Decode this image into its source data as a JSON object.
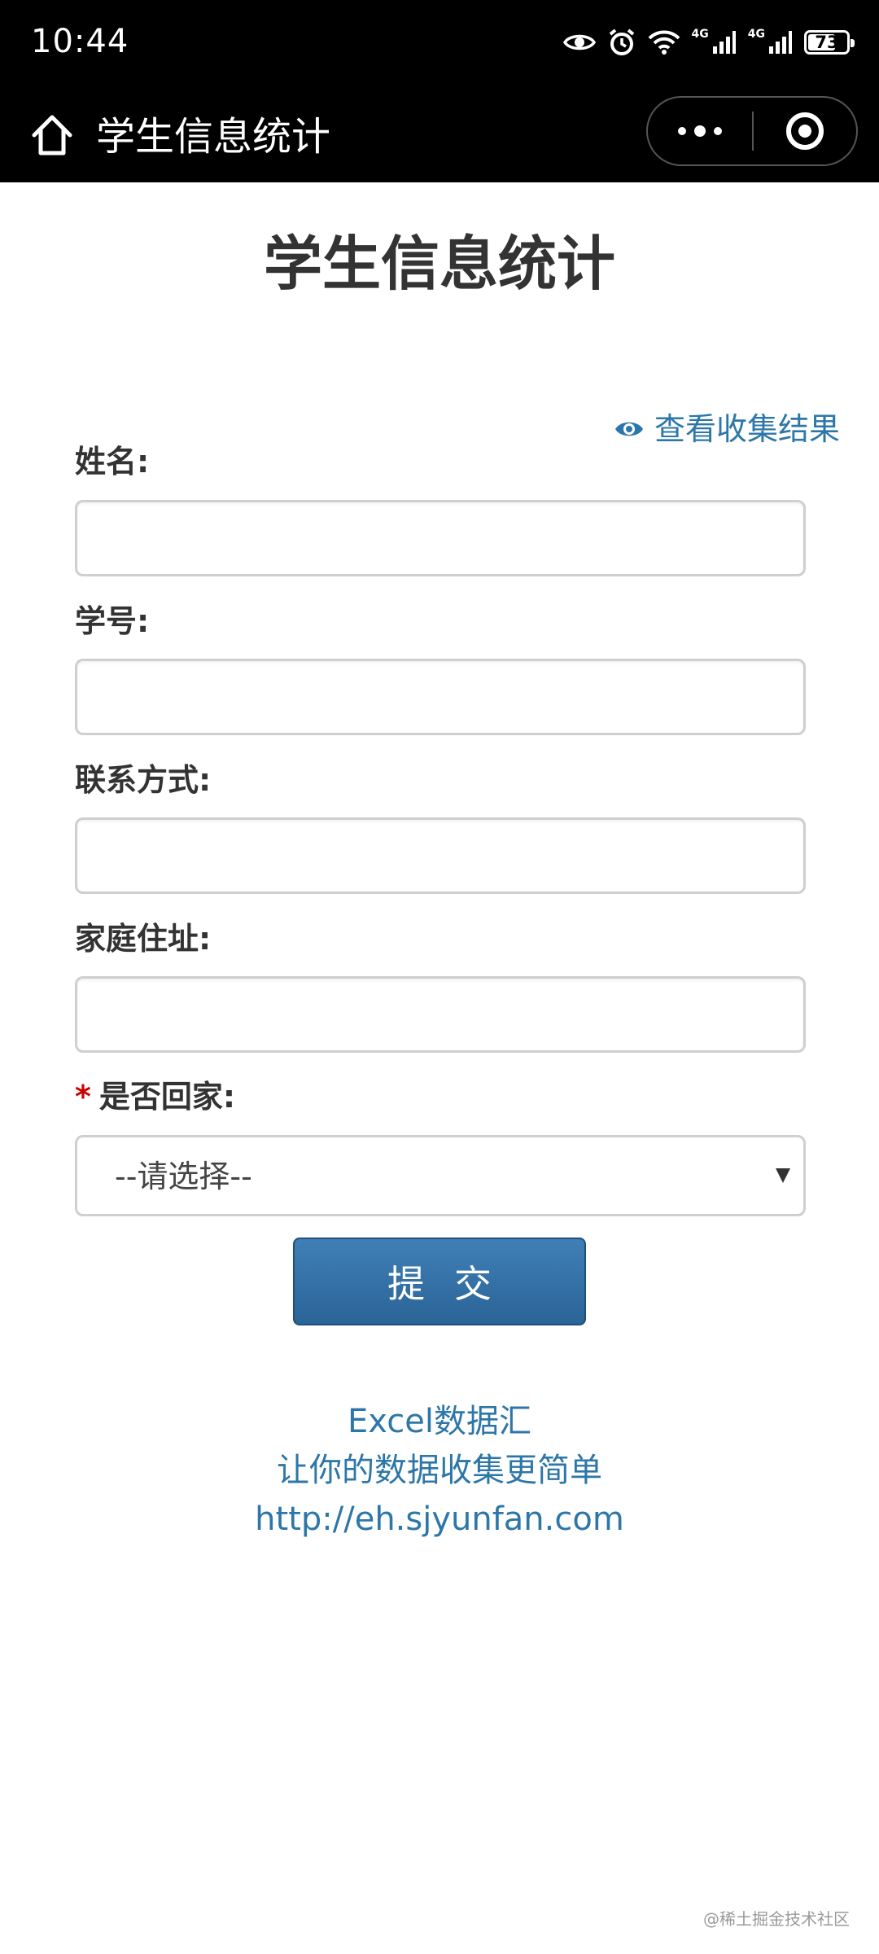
{
  "status_bar": {
    "time": "10:44",
    "network_1": "4G",
    "network_2": "4G",
    "battery": "73",
    "battery_level": 0.73
  },
  "nav": {
    "title": "学生信息统计",
    "home_icon": "home-icon",
    "more_icon": "more-dots-icon",
    "close_icon": "target-circle-icon"
  },
  "form": {
    "title": "学生信息统计",
    "view_results_label": "查看收集结果",
    "fields": [
      {
        "label": "姓名:",
        "value": "",
        "placeholder": ""
      },
      {
        "label": "学号:",
        "value": "",
        "placeholder": ""
      },
      {
        "label": "联系方式:",
        "value": "",
        "placeholder": ""
      },
      {
        "label": "家庭住址:",
        "value": "",
        "placeholder": ""
      }
    ],
    "select": {
      "required_mark": "*",
      "label": "是否回家:",
      "selected": "--请选择--"
    },
    "submit_label": "提交"
  },
  "footer": {
    "line1": "Excel数据汇",
    "line2": "让你的数据收集更简单",
    "line3": "http://eh.sjyunfan.com"
  },
  "watermark": "@稀土掘金技术社区",
  "colors": {
    "accent": "#2d77a8",
    "button": "#2b6497",
    "required": "#cc0000"
  }
}
